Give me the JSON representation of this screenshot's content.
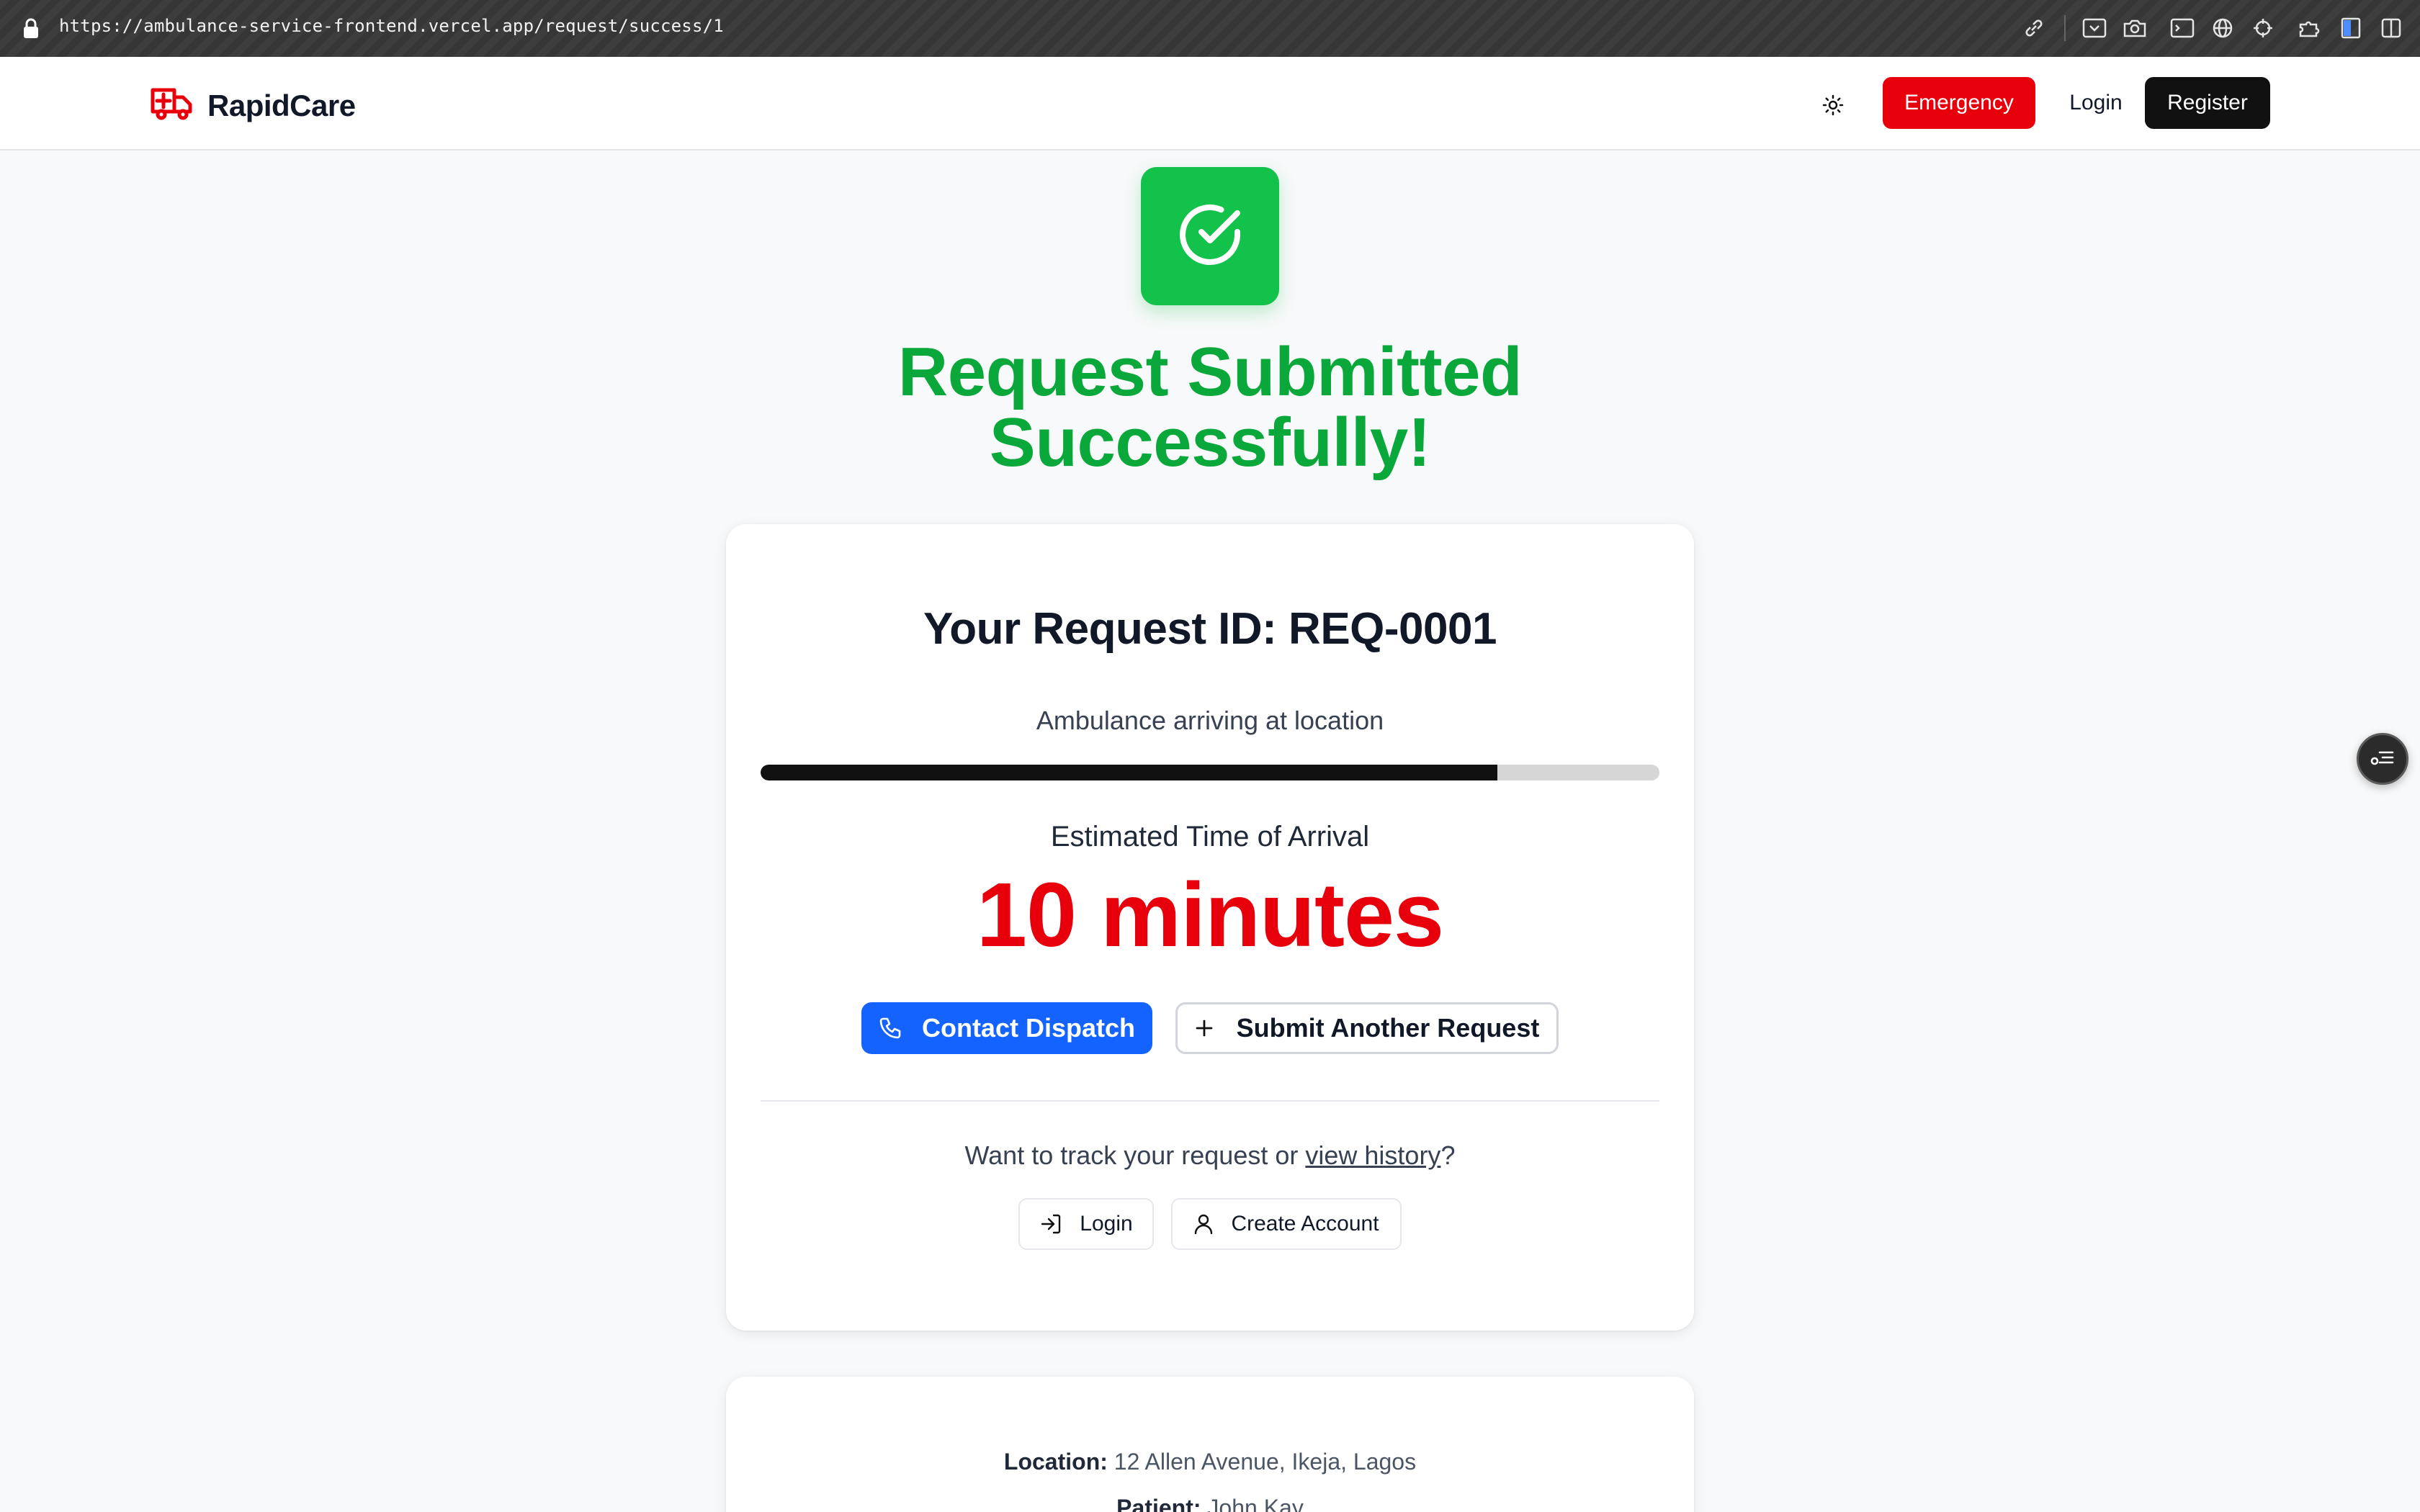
{
  "browser": {
    "url": "https://ambulance-service-frontend.vercel.app/request/success/1"
  },
  "nav": {
    "brand": "RapidCare",
    "emergency_label": "Emergency",
    "login_label": "Login",
    "register_label": "Register"
  },
  "hero": {
    "headline_line1": "Request Submitted",
    "headline_line2": "Successfully!"
  },
  "request": {
    "id_label": "Your Request ID: REQ-0001",
    "status": "Ambulance arriving at location",
    "progress_fraction": 0.82,
    "eta_label": "Estimated Time of Arrival",
    "eta_value": "10 minutes"
  },
  "actions": {
    "contact_dispatch": "Contact Dispatch",
    "submit_another": "Submit Another Request"
  },
  "account_prompt": {
    "text_before": "Want to track your request or ",
    "link_text": "view history",
    "text_after": "?",
    "login_label": "Login",
    "create_account_label": "Create Account"
  },
  "details": {
    "location_label": "Location:",
    "location_value": "12 Allen Avenue, Ikeja, Lagos",
    "patient_label": "Patient:",
    "patient_value": "John Kay"
  },
  "colors": {
    "success": "#12c24a",
    "headline": "#0aa83a",
    "emergency": "#e7000b",
    "dispatch": "#1563ff"
  }
}
